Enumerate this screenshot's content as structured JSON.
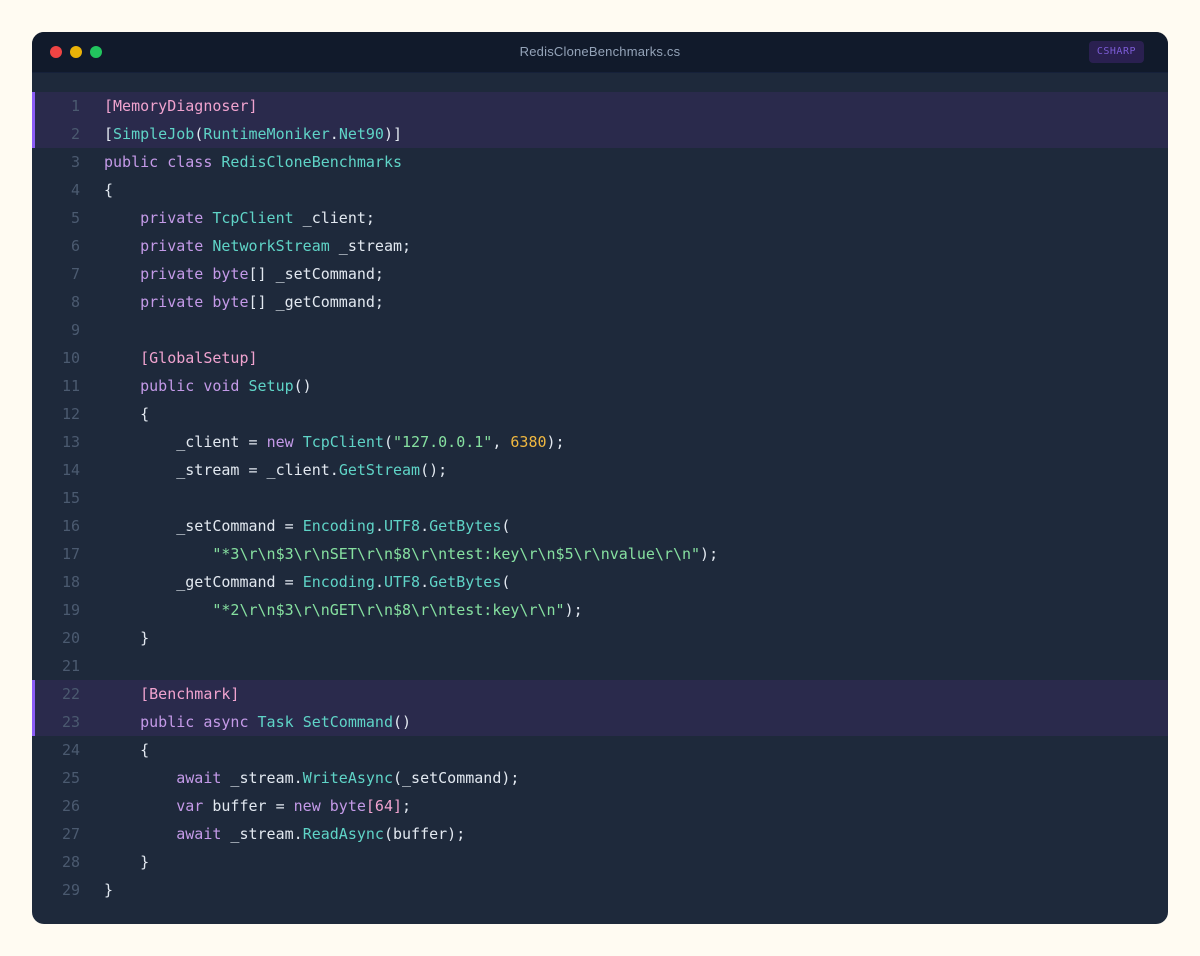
{
  "window": {
    "title": "RedisCloneBenchmarks.cs",
    "language_badge": "CSHARP"
  },
  "colors": {
    "background": "#fffbf2",
    "editor": "#1e293b",
    "titlebar": "#111a2b",
    "highlight": "#2a2a4c",
    "highlight_bar": "#8b5cf6",
    "attribute": "#f0a3cf",
    "keyword": "#c49ae8",
    "type": "#5fd4c7",
    "string": "#86e0a0",
    "number": "#f0b840",
    "plain": "#e2e8f0"
  },
  "code": {
    "highlighted_lines": [
      1,
      2,
      22,
      23
    ],
    "lines": [
      {
        "n": "1",
        "tokens": [
          {
            "c": "attr",
            "t": "[MemoryDiagnoser]"
          }
        ]
      },
      {
        "n": "2",
        "tokens": [
          {
            "c": "plain",
            "t": "["
          },
          {
            "c": "type",
            "t": "SimpleJob"
          },
          {
            "c": "plain",
            "t": "("
          },
          {
            "c": "type",
            "t": "RuntimeMoniker"
          },
          {
            "c": "plain",
            "t": "."
          },
          {
            "c": "type",
            "t": "Net90"
          },
          {
            "c": "plain",
            "t": ")]"
          }
        ]
      },
      {
        "n": "3",
        "tokens": [
          {
            "c": "kw",
            "t": "public"
          },
          {
            "c": "plain",
            "t": " "
          },
          {
            "c": "kw",
            "t": "class"
          },
          {
            "c": "plain",
            "t": " "
          },
          {
            "c": "type",
            "t": "RedisCloneBenchmarks"
          }
        ]
      },
      {
        "n": "4",
        "tokens": [
          {
            "c": "plain",
            "t": "{"
          }
        ]
      },
      {
        "n": "5",
        "tokens": [
          {
            "c": "plain",
            "t": "    "
          },
          {
            "c": "kw",
            "t": "private"
          },
          {
            "c": "plain",
            "t": " "
          },
          {
            "c": "type",
            "t": "TcpClient"
          },
          {
            "c": "plain",
            "t": " _client;"
          }
        ]
      },
      {
        "n": "6",
        "tokens": [
          {
            "c": "plain",
            "t": "    "
          },
          {
            "c": "kw",
            "t": "private"
          },
          {
            "c": "plain",
            "t": " "
          },
          {
            "c": "type",
            "t": "NetworkStream"
          },
          {
            "c": "plain",
            "t": " _stream;"
          }
        ]
      },
      {
        "n": "7",
        "tokens": [
          {
            "c": "plain",
            "t": "    "
          },
          {
            "c": "kw",
            "t": "private"
          },
          {
            "c": "plain",
            "t": " "
          },
          {
            "c": "kw",
            "t": "byte"
          },
          {
            "c": "plain",
            "t": "[] _setCommand;"
          }
        ]
      },
      {
        "n": "8",
        "tokens": [
          {
            "c": "plain",
            "t": "    "
          },
          {
            "c": "kw",
            "t": "private"
          },
          {
            "c": "plain",
            "t": " "
          },
          {
            "c": "kw",
            "t": "byte"
          },
          {
            "c": "plain",
            "t": "[] _getCommand;"
          }
        ]
      },
      {
        "n": "9",
        "tokens": []
      },
      {
        "n": "10",
        "tokens": [
          {
            "c": "plain",
            "t": "    "
          },
          {
            "c": "attr",
            "t": "[GlobalSetup]"
          }
        ]
      },
      {
        "n": "11",
        "tokens": [
          {
            "c": "plain",
            "t": "    "
          },
          {
            "c": "kw",
            "t": "public"
          },
          {
            "c": "plain",
            "t": " "
          },
          {
            "c": "kw",
            "t": "void"
          },
          {
            "c": "plain",
            "t": " "
          },
          {
            "c": "type",
            "t": "Setup"
          },
          {
            "c": "plain",
            "t": "()"
          }
        ]
      },
      {
        "n": "12",
        "tokens": [
          {
            "c": "plain",
            "t": "    {"
          }
        ]
      },
      {
        "n": "13",
        "tokens": [
          {
            "c": "plain",
            "t": "        _client = "
          },
          {
            "c": "kw",
            "t": "new"
          },
          {
            "c": "plain",
            "t": " "
          },
          {
            "c": "type",
            "t": "TcpClient"
          },
          {
            "c": "plain",
            "t": "("
          },
          {
            "c": "str",
            "t": "\"127.0.0.1\""
          },
          {
            "c": "plain",
            "t": ", "
          },
          {
            "c": "num",
            "t": "6380"
          },
          {
            "c": "plain",
            "t": ");"
          }
        ]
      },
      {
        "n": "14",
        "tokens": [
          {
            "c": "plain",
            "t": "        _stream = _client."
          },
          {
            "c": "type",
            "t": "GetStream"
          },
          {
            "c": "plain",
            "t": "();"
          }
        ]
      },
      {
        "n": "15",
        "tokens": []
      },
      {
        "n": "16",
        "tokens": [
          {
            "c": "plain",
            "t": "        _setCommand = "
          },
          {
            "c": "type",
            "t": "Encoding"
          },
          {
            "c": "plain",
            "t": "."
          },
          {
            "c": "type",
            "t": "UTF8"
          },
          {
            "c": "plain",
            "t": "."
          },
          {
            "c": "type",
            "t": "GetBytes"
          },
          {
            "c": "plain",
            "t": "("
          }
        ]
      },
      {
        "n": "17",
        "tokens": [
          {
            "c": "plain",
            "t": "            "
          },
          {
            "c": "str",
            "t": "\"*3\\r\\n$3\\r\\nSET\\r\\n$8\\r\\ntest:key\\r\\n$5\\r\\nvalue\\r\\n\""
          },
          {
            "c": "plain",
            "t": ");"
          }
        ]
      },
      {
        "n": "18",
        "tokens": [
          {
            "c": "plain",
            "t": "        _getCommand = "
          },
          {
            "c": "type",
            "t": "Encoding"
          },
          {
            "c": "plain",
            "t": "."
          },
          {
            "c": "type",
            "t": "UTF8"
          },
          {
            "c": "plain",
            "t": "."
          },
          {
            "c": "type",
            "t": "GetBytes"
          },
          {
            "c": "plain",
            "t": "("
          }
        ]
      },
      {
        "n": "19",
        "tokens": [
          {
            "c": "plain",
            "t": "            "
          },
          {
            "c": "str",
            "t": "\"*2\\r\\n$3\\r\\nGET\\r\\n$8\\r\\ntest:key\\r\\n\""
          },
          {
            "c": "plain",
            "t": ");"
          }
        ]
      },
      {
        "n": "20",
        "tokens": [
          {
            "c": "plain",
            "t": "    }"
          }
        ]
      },
      {
        "n": "21",
        "tokens": []
      },
      {
        "n": "22",
        "tokens": [
          {
            "c": "plain",
            "t": "    "
          },
          {
            "c": "attr",
            "t": "[Benchmark]"
          }
        ]
      },
      {
        "n": "23",
        "tokens": [
          {
            "c": "plain",
            "t": "    "
          },
          {
            "c": "kw",
            "t": "public"
          },
          {
            "c": "plain",
            "t": " "
          },
          {
            "c": "kw",
            "t": "async"
          },
          {
            "c": "plain",
            "t": " "
          },
          {
            "c": "type",
            "t": "Task"
          },
          {
            "c": "plain",
            "t": " "
          },
          {
            "c": "type",
            "t": "SetCommand"
          },
          {
            "c": "plain",
            "t": "()"
          }
        ]
      },
      {
        "n": "24",
        "tokens": [
          {
            "c": "plain",
            "t": "    {"
          }
        ]
      },
      {
        "n": "25",
        "tokens": [
          {
            "c": "plain",
            "t": "        "
          },
          {
            "c": "kw",
            "t": "await"
          },
          {
            "c": "plain",
            "t": " _stream."
          },
          {
            "c": "type",
            "t": "WriteAsync"
          },
          {
            "c": "plain",
            "t": "(_setCommand);"
          }
        ]
      },
      {
        "n": "26",
        "tokens": [
          {
            "c": "plain",
            "t": "        "
          },
          {
            "c": "kw",
            "t": "var"
          },
          {
            "c": "plain",
            "t": " buffer = "
          },
          {
            "c": "kw",
            "t": "new"
          },
          {
            "c": "plain",
            "t": " "
          },
          {
            "c": "kw",
            "t": "byte"
          },
          {
            "c": "attr",
            "t": "[64]"
          },
          {
            "c": "plain",
            "t": ";"
          }
        ]
      },
      {
        "n": "27",
        "tokens": [
          {
            "c": "plain",
            "t": "        "
          },
          {
            "c": "kw",
            "t": "await"
          },
          {
            "c": "plain",
            "t": " _stream."
          },
          {
            "c": "type",
            "t": "ReadAsync"
          },
          {
            "c": "plain",
            "t": "(buffer);"
          }
        ]
      },
      {
        "n": "28",
        "tokens": [
          {
            "c": "plain",
            "t": "    }"
          }
        ]
      },
      {
        "n": "29",
        "tokens": [
          {
            "c": "plain",
            "t": "}"
          }
        ]
      }
    ]
  }
}
